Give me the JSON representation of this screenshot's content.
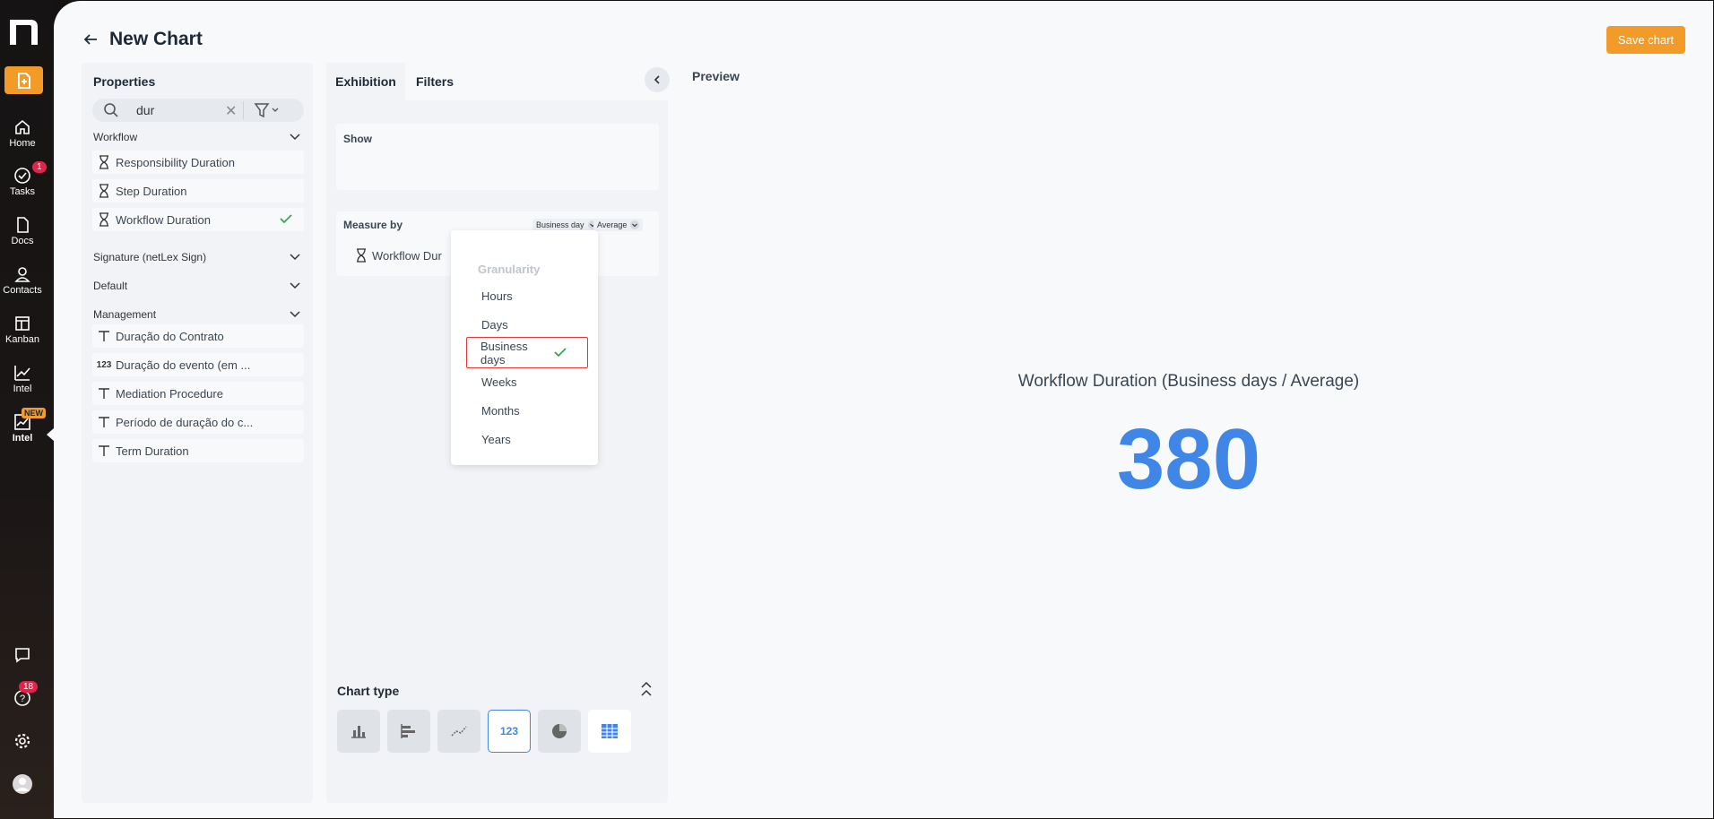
{
  "nav": {
    "items": [
      {
        "label": "Home",
        "icon": "home-icon"
      },
      {
        "label": "Tasks",
        "icon": "check-circle-icon",
        "badge": "1"
      },
      {
        "label": "Docs",
        "icon": "document-icon"
      },
      {
        "label": "Contacts",
        "icon": "person-icon"
      },
      {
        "label": "Kanban",
        "icon": "kanban-icon"
      },
      {
        "label": "Intel",
        "icon": "chart-line-icon"
      },
      {
        "label": "Intel",
        "icon": "chart-new-icon",
        "tag": "NEW"
      }
    ],
    "help_badge": "18"
  },
  "header": {
    "title": "New Chart",
    "save_label": "Save chart"
  },
  "properties": {
    "title": "Properties",
    "search_value": "dur",
    "groups": {
      "workflow": "Workflow",
      "signature": "Signature (netLex Sign)",
      "default": "Default",
      "management": "Management"
    },
    "workflow_items": [
      "Responsibility Duration",
      "Step Duration",
      "Workflow Duration"
    ],
    "management_items": [
      {
        "icon": "T",
        "label": "Duração do Contrato"
      },
      {
        "icon": "123",
        "label": "Duração do evento (em ..."
      },
      {
        "icon": "T",
        "label": "Mediation Procedure"
      },
      {
        "icon": "T",
        "label": "Período de duração do c..."
      },
      {
        "icon": "T",
        "label": "Term Duration"
      }
    ]
  },
  "exhibition": {
    "tab_exhibition": "Exhibition",
    "tab_filters": "Filters",
    "show_label": "Show",
    "measure_label": "Measure by",
    "granularity_value": "Business day",
    "aggregation_value": "Average",
    "measure_item": "Workflow Dur"
  },
  "dropdown": {
    "heading": "Granularity",
    "options": [
      "Hours",
      "Days",
      "Business days",
      "Weeks",
      "Months",
      "Years"
    ],
    "selected_line1": "Business",
    "selected_line2": "days"
  },
  "chart_type": {
    "label": "Chart type",
    "active_label": "123"
  },
  "preview": {
    "label": "Preview",
    "kpi_title": "Workflow Duration (Business days / Average)",
    "kpi_value": "380"
  },
  "colors": {
    "accent": "#f39b29",
    "kpi": "#3f86e6",
    "check": "#3aa655",
    "highlight": "#e53935"
  }
}
